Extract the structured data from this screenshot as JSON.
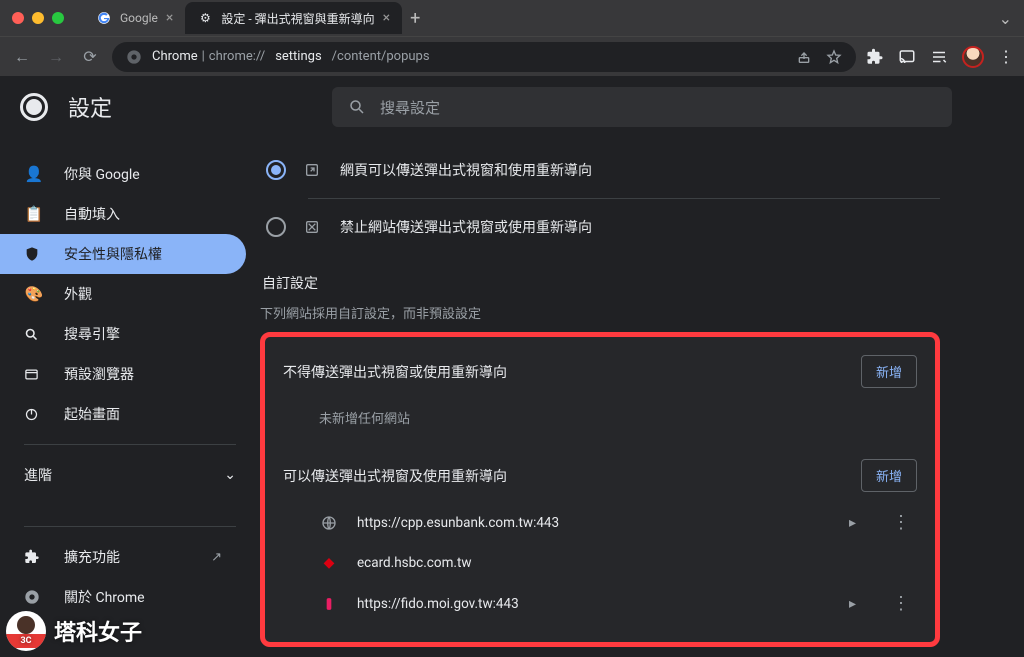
{
  "tabs": [
    {
      "title": "Google",
      "active": false
    },
    {
      "title": "設定 - 彈出式視窗與重新導向",
      "active": true
    }
  ],
  "url": {
    "scheme": "Chrome",
    "sep": " | ",
    "path_prefix": "chrome://",
    "path_bold": "settings",
    "path_rest": "/content/popups"
  },
  "header": {
    "title": "設定",
    "search_placeholder": "搜尋設定"
  },
  "sidebar": {
    "items": [
      {
        "icon": "person",
        "label": "你與 Google"
      },
      {
        "icon": "clipboard",
        "label": "自動填入"
      },
      {
        "icon": "shield",
        "label": "安全性與隱私權",
        "active": true
      },
      {
        "icon": "palette",
        "label": "外觀"
      },
      {
        "icon": "search",
        "label": "搜尋引擎"
      },
      {
        "icon": "browser",
        "label": "預設瀏覽器"
      },
      {
        "icon": "power",
        "label": "起始畫面"
      }
    ],
    "advanced": "進階",
    "extensions": "擴充功能",
    "about": "關於 Chrome"
  },
  "content": {
    "radio_allow": "網頁可以傳送彈出式視窗和使用重新導向",
    "radio_block": "禁止網站傳送彈出式視窗或使用重新導向",
    "custom_title": "自訂設定",
    "custom_sub": "下列網站採用自訂設定，而非預設設定",
    "block_header": "不得傳送彈出式視窗或使用重新導向",
    "add": "新增",
    "empty": "未新增任何網站",
    "allow_header": "可以傳送彈出式視窗及使用重新導向",
    "sites": [
      {
        "icon": "globe",
        "url": "https://cpp.esunbank.com.tw:443",
        "icon_color": "#9aa0a6"
      },
      {
        "icon": "hsbc",
        "url": "ecard.hsbc.com.tw",
        "icon_color": "#db0011"
      },
      {
        "icon": "key",
        "url": "https://fido.moi.gov.tw:443",
        "icon_color": "#e91e63"
      }
    ]
  },
  "watermark": "塔科女子"
}
